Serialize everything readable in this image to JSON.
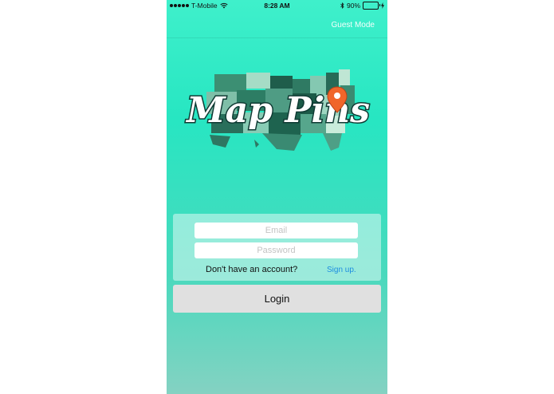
{
  "status_bar": {
    "carrier": "T-Mobile",
    "time": "8:28 AM",
    "battery": "90%",
    "battery_level": 0.9
  },
  "nav": {
    "guest_mode": "Guest Mode"
  },
  "logo": {
    "text": "Map Pins",
    "pin_color": "#f0662b"
  },
  "login": {
    "email_placeholder": "Email",
    "password_placeholder": "Password",
    "no_account": "Don't have an account?",
    "signup": "Sign up.",
    "button": "Login"
  }
}
